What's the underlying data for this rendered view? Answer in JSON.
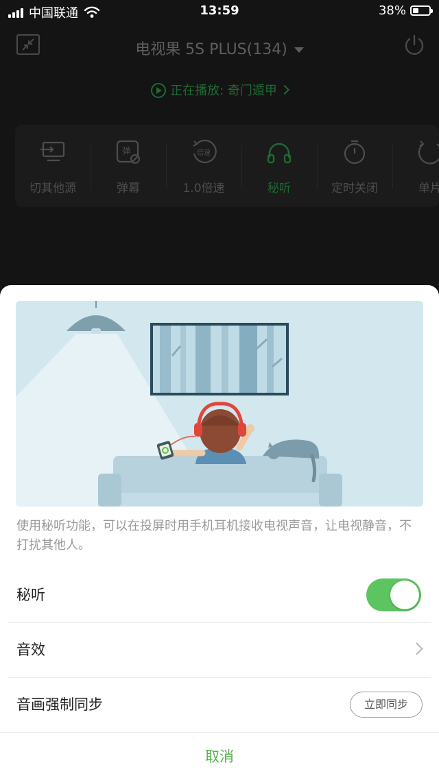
{
  "status_bar": {
    "carrier": "中国联通",
    "time": "13:59",
    "battery_percent": "38%",
    "battery_level": 0.38,
    "icons": [
      "signal-icon",
      "wifi-icon",
      "battery-icon"
    ]
  },
  "header": {
    "device_name": "电视果 5S PLUS(134)",
    "now_playing": "正在播放: 奇门遁甲"
  },
  "toolbar": {
    "items": [
      {
        "label": "切其他源",
        "icon": "switch-source-icon"
      },
      {
        "label": "弹幕",
        "icon": "danmaku-icon"
      },
      {
        "label": "1.0倍速",
        "icon": "speed-icon"
      },
      {
        "label": "秘听",
        "icon": "headphones-icon"
      },
      {
        "label": "定时关闭",
        "icon": "timer-icon"
      },
      {
        "label": "单片",
        "icon": "loop-icon"
      }
    ]
  },
  "sheet": {
    "illustration_alt": "秘听",
    "description": "使用秘听功能，可以在投屏时用手机耳机接收电视声音，让电视静音，不打扰其他人。",
    "rows": [
      {
        "label": "秘听",
        "control": "toggle",
        "on": true
      },
      {
        "label": "音效",
        "control": "chevron"
      },
      {
        "label": "音画强制同步",
        "control": "button",
        "button_label": "立即同步"
      }
    ],
    "cancel_label": "取消"
  },
  "colors": {
    "accent_green": "#5cc460",
    "cancel_green": "#55b04f",
    "dim_green": "#1f6a33",
    "background_dark": "#141414"
  }
}
